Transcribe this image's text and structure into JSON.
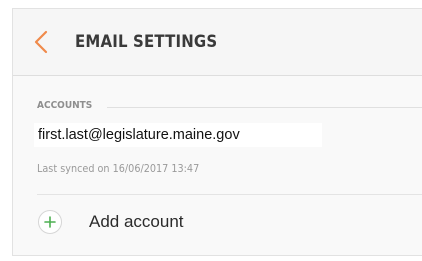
{
  "header": {
    "title": "EMAIL SETTINGS",
    "back_icon": "chevron-left-icon"
  },
  "accounts_section": {
    "heading": "ACCOUNTS",
    "account": {
      "email": "first.last@legislature.maine.gov",
      "sync_status": "Last synced on 16/06/2017  13:47"
    },
    "add_account": {
      "label": "Add account",
      "icon": "plus-icon"
    }
  },
  "colors": {
    "accent_back": "#f08a4b",
    "accent_plus": "#4caf50",
    "title_text": "#3a3a3a",
    "muted_text": "#9a9a9a",
    "background": "#f8f8f8"
  }
}
